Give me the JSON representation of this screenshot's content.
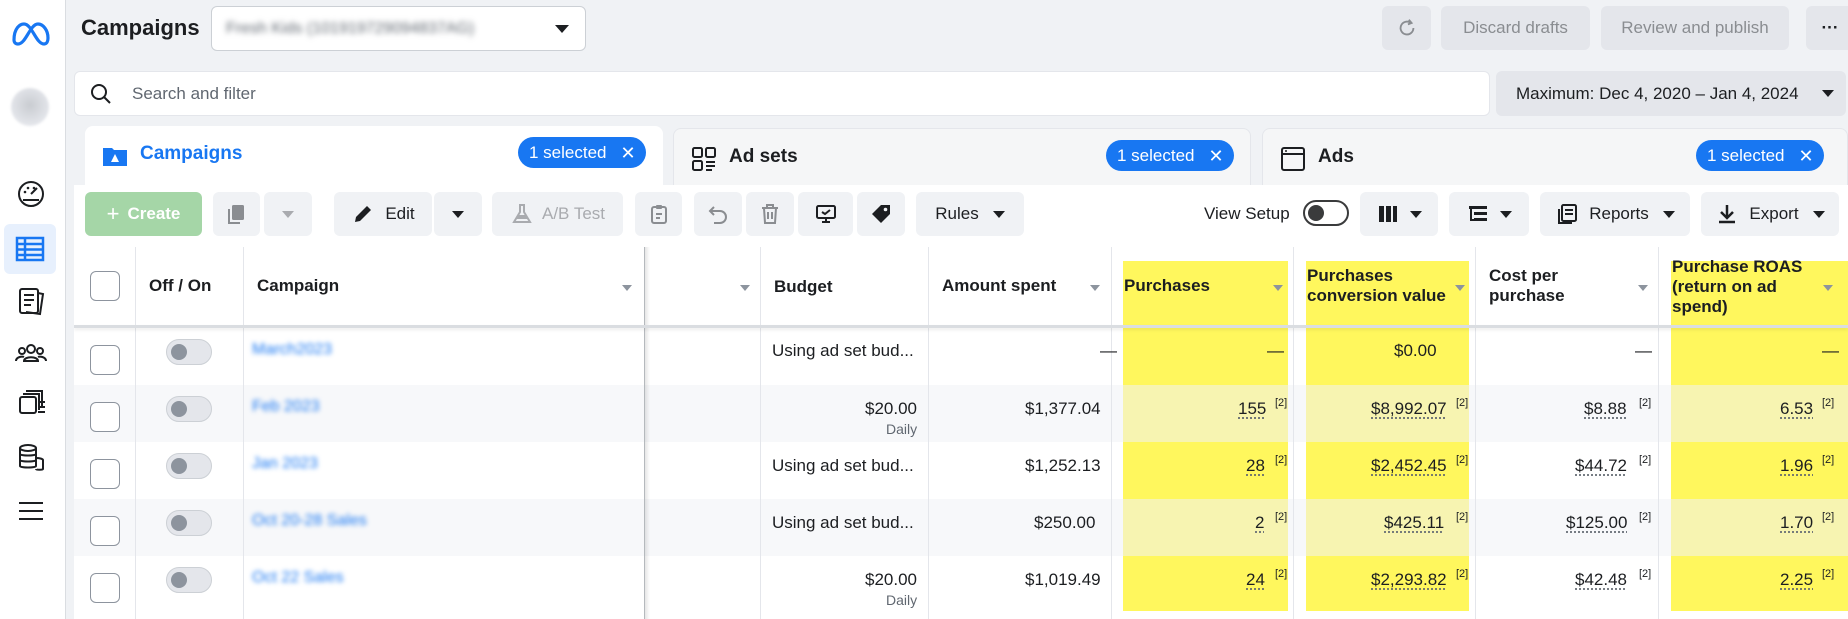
{
  "header": {
    "title": "Campaigns",
    "account": "Fresh Kids (101919729094837AG)",
    "discard": "Discard drafts",
    "review": "Review and publish",
    "more": "···"
  },
  "search": {
    "placeholder": "Search and filter"
  },
  "date_range": "Maximum: Dec 4, 2020 – Jan 4, 2024",
  "tabs": [
    {
      "label": "Campaigns",
      "selected": "1 selected",
      "active": true
    },
    {
      "label": "Ad sets",
      "selected": "1 selected",
      "active": false
    },
    {
      "label": "Ads",
      "selected": "1 selected",
      "active": false
    }
  ],
  "toolbar": {
    "create": "Create",
    "edit": "Edit",
    "ab_test": "A/B Test",
    "rules": "Rules",
    "view_setup": "View Setup",
    "reports": "Reports",
    "export": "Export"
  },
  "columns": {
    "off_on": "Off / On",
    "campaign": "Campaign",
    "budget": "Budget",
    "amount_spent": "Amount spent",
    "purchases": "Purchases",
    "conv_value_1": "Purchases",
    "conv_value_2": "conversion value",
    "cpp_1": "Cost per",
    "cpp_2": "purchase",
    "roas_1": "Purchase ROAS",
    "roas_2": "(return on ad",
    "roas_3": "spend)"
  },
  "footnote": "[2]",
  "rows": [
    {
      "name": "March2023",
      "budget": "Using ad set bud...",
      "budget_sub": "",
      "spent": "—",
      "purchases": "—",
      "conv_value": "$0.00",
      "cpp": "—",
      "roas": "—"
    },
    {
      "name": "Feb 2023",
      "budget": "$20.00",
      "budget_sub": "Daily",
      "spent": "$1,377.04",
      "purchases": "155",
      "conv_value": "$8,992.07",
      "cpp": "$8.88",
      "roas": "6.53"
    },
    {
      "name": "Jan 2023",
      "budget": "Using ad set bud...",
      "budget_sub": "",
      "spent": "$1,252.13",
      "purchases": "28",
      "conv_value": "$2,452.45",
      "cpp": "$44.72",
      "roas": "1.96"
    },
    {
      "name": "Oct 20-28 Sales",
      "budget": "Using ad set bud...",
      "budget_sub": "",
      "spent": "$250.00",
      "purchases": "2",
      "conv_value": "$425.11",
      "cpp": "$125.00",
      "roas": "1.70"
    },
    {
      "name": "Oct 22 Sales",
      "budget": "$20.00",
      "budget_sub": "Daily",
      "spent": "$1,019.49",
      "purchases": "24",
      "conv_value": "$2,293.82",
      "cpp": "$42.48",
      "roas": "2.25"
    }
  ],
  "colors": {
    "accent": "#1877f2",
    "highlight": "#fff75d",
    "create_green": "#a5d6a7"
  }
}
